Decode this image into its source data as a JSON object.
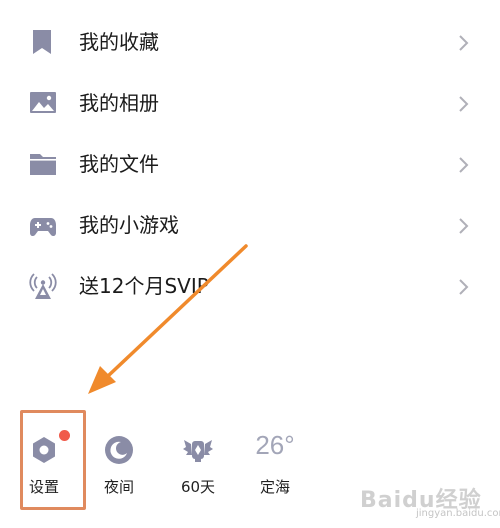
{
  "menu": {
    "items": [
      {
        "label": "我的收藏",
        "icon": "bookmark-icon"
      },
      {
        "label": "我的相册",
        "icon": "photo-icon"
      },
      {
        "label": "我的文件",
        "icon": "folder-icon"
      },
      {
        "label": "我的小游戏",
        "icon": "gamepad-icon"
      },
      {
        "label": "送12个月SVIP",
        "icon": "broadcast-tower-icon"
      }
    ]
  },
  "toolbar": {
    "settings_label": "设置",
    "night_label": "夜间",
    "days_label": "60天",
    "weather_temp": "26°",
    "weather_label": "定海"
  },
  "watermark": {
    "text": "Baidu经验",
    "sub": "jingyan.baidu.com"
  },
  "colors": {
    "icon_gray": "#8a8ca6",
    "chevron": "#b0b0b8",
    "arrow": "#f08a2c",
    "highlight_border": "#e08a5e",
    "badge_red": "#f05a4a"
  }
}
